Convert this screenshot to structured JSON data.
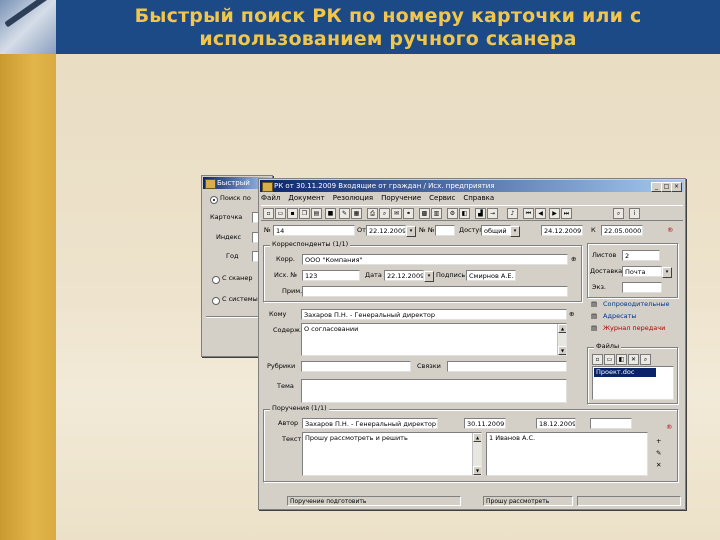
{
  "slide": {
    "title_line1": "Быстрый поиск РК по номеру карточки или с",
    "title_line2": "использованием ручного сканера"
  },
  "search_dialog": {
    "title": "Быстрый",
    "radio1": "Поиск по",
    "label_card": "Карточка",
    "label_index": "Индекс",
    "label_year": "Год",
    "radio2": "С сканер",
    "radio3": "С системы"
  },
  "card_window": {
    "title": "РК от 30.11.2009 Входящие от граждан / Исх. предприятия",
    "menu": [
      "Файл",
      "Документ",
      "Резолюция",
      "Поручение",
      "Сервис",
      "Справка"
    ],
    "reg_number_label": "№",
    "reg_number_value": "14",
    "date_label": "От",
    "date_value": "22.12.2009",
    "no_label": "№ №",
    "access_label": "Доступ",
    "access_value": "общий",
    "plan_date_value": "24.12.2009",
    "control_label": "К",
    "control_value": "22.05.0000",
    "corr_group_title": "Корреспонденты (1/1)",
    "org_label": "Корр.",
    "org_value": "ООО \"Компания\"",
    "ref_label": "Исх. №",
    "ref_value": "123",
    "ref_date_label": "Дата",
    "ref_date_value": "22.12.2009",
    "signer_label": "Подпись",
    "signer_value": "Смирнов А.Е.",
    "note_label": "Прим.",
    "delivery_label": "Доставка",
    "delivery_value": "Почта",
    "sheets_label": "Листов",
    "sheets_value": "2",
    "copies_label": "Экз.",
    "to_label": "Кому",
    "to_value": "Захаров П.Н. - Генеральный директор",
    "content_label": "Содерж.",
    "content_value": "О согласовании",
    "links_label": "Рубрики",
    "links2_label": "Связки",
    "theme_label": "Тема",
    "files_group_title": "Файлы",
    "file_name": "Проект.doc",
    "side_link1": "Сопроводительные",
    "side_link2": "Адресаты",
    "side_link3": "Журнал передачи",
    "res_group_title": "Поручения (1/1)",
    "res_author_label": "Автор",
    "res_author_value": "Захаров П.Н. - Генеральный директор",
    "res_date_value": "30.11.2009",
    "res_plan_value": "18.12.2009",
    "res_text_label": "Текст",
    "res_text_value": "Прошу рассмотреть и решить",
    "res_executor_value": "1 Иванов А.С.",
    "status1": "Поручение подготовить",
    "status2": "Прошу рассмотреть"
  },
  "colors": {
    "header_blue": "#1c4a86",
    "title_gold": "#f0c64c",
    "strip_gold": "#d8ab40",
    "win_gray": "#d4d0c8"
  }
}
